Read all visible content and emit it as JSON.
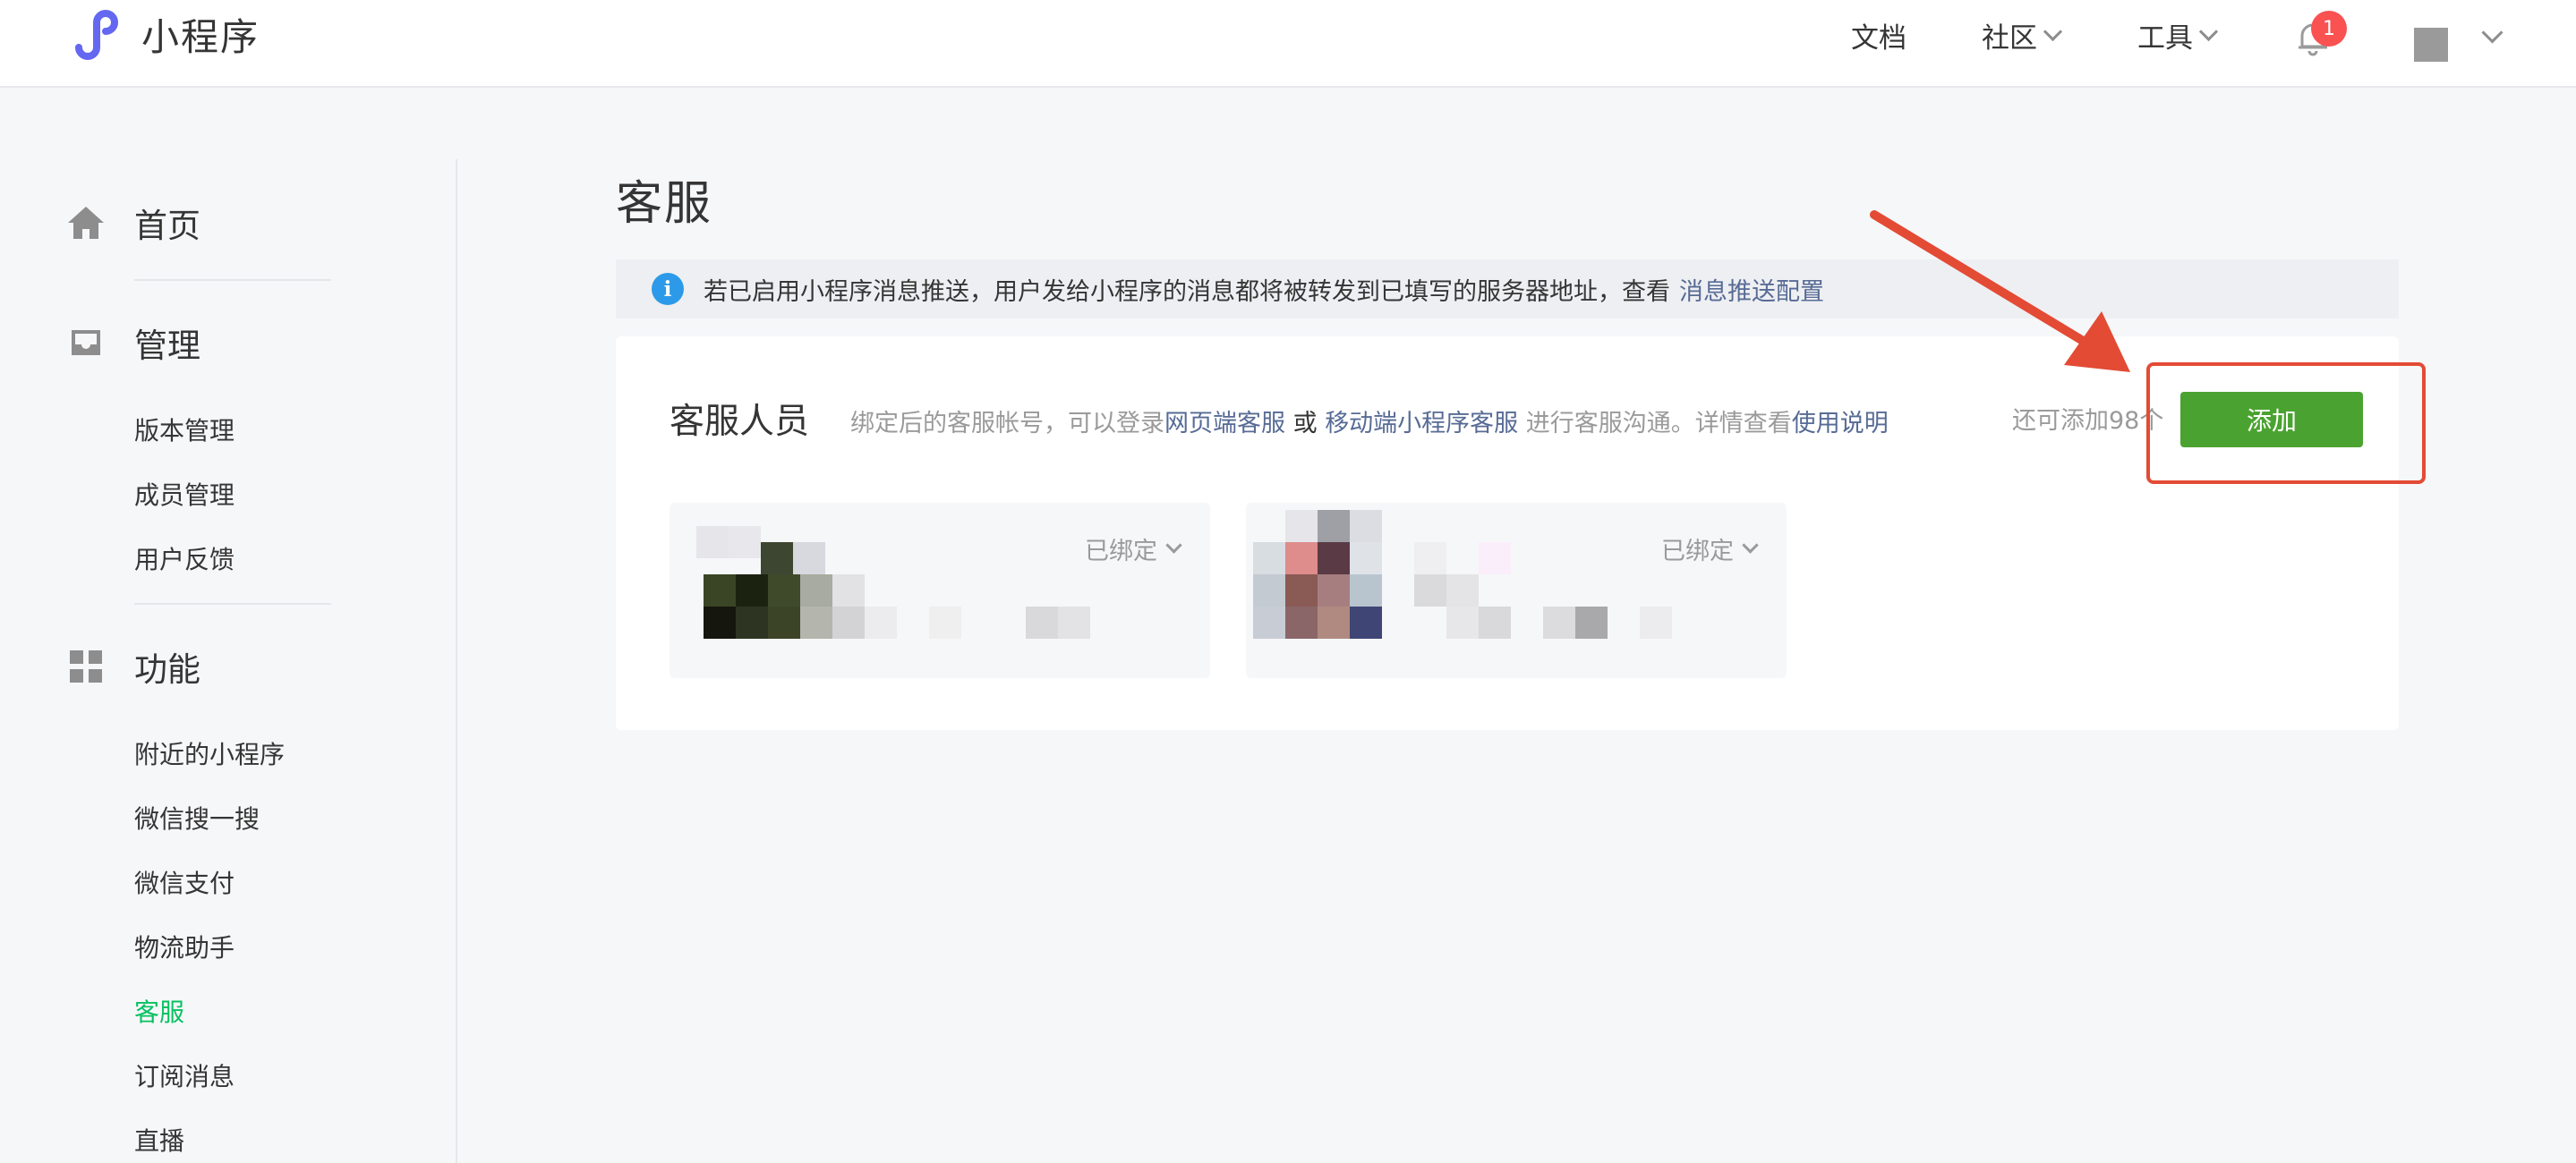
{
  "header": {
    "logo_text": "小程序",
    "nav": [
      {
        "label": "文档"
      },
      {
        "label": "社区"
      },
      {
        "label": "工具"
      }
    ],
    "notification_count": "1"
  },
  "sidebar": {
    "sections": [
      {
        "label": "首页",
        "icon": "home-icon"
      },
      {
        "label": "管理",
        "icon": "inbox-icon"
      },
      {
        "label": "功能",
        "icon": "grid-icon"
      }
    ],
    "management_items": [
      "版本管理",
      "成员管理",
      "用户反馈"
    ],
    "feature_items": [
      "附近的小程序",
      "微信搜一搜",
      "微信支付",
      "物流助手",
      "客服",
      "订阅消息",
      "直播"
    ],
    "active_item": "客服"
  },
  "main": {
    "page_title": "客服",
    "notice": {
      "text": "若已启用小程序消息推送，用户发给小程序的消息都将被转发到已填写的服务器地址，查看",
      "link": "消息推送配置"
    },
    "staff_card": {
      "title": "客服人员",
      "desc_prefix": "绑定后的客服帐号，可以登录",
      "link_web": "网页端客服",
      "or": "或",
      "link_mobile": "移动端小程序客服",
      "desc_suffix": "进行客服沟通。详情查看",
      "link_help": "使用说明",
      "remaining": "还可添加98个",
      "add_button": "添加",
      "members": [
        {
          "status": "已绑定"
        },
        {
          "status": "已绑定"
        }
      ]
    }
  },
  "colors": {
    "accent_green": "#07c160",
    "button_green": "#4aa330",
    "link_blue": "#576b95",
    "annotation_red": "#e34b35",
    "badge_red": "#fa5151"
  }
}
